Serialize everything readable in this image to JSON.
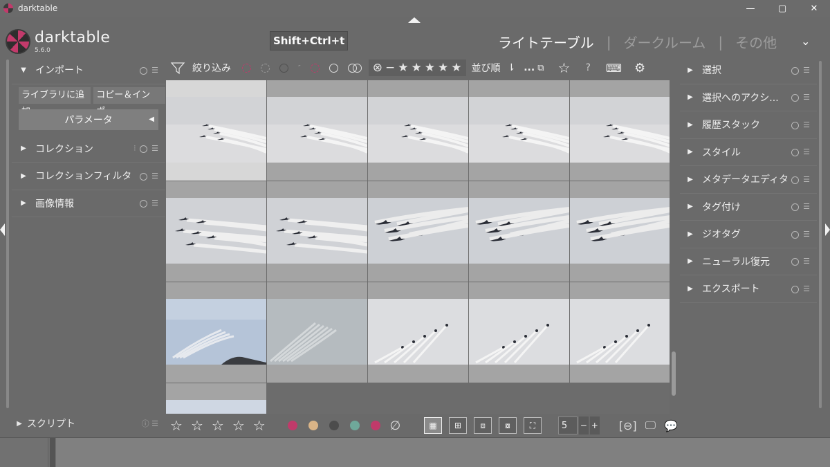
{
  "window": {
    "title": "darktable",
    "min": "—",
    "max": "▢",
    "close": "✕"
  },
  "header": {
    "logo_text": "darktable",
    "version": "5.6.0",
    "shortcut_tip": "Shift+Ctrl+t",
    "views": [
      "ライトテーブル",
      "ダークルーム",
      "その他"
    ],
    "separator": "|",
    "expand": "⌄"
  },
  "left_panel": {
    "import": {
      "label": "インポート",
      "add_to_library": "ライブラリに追加",
      "copy_import": "コピー＆インポ...",
      "params": "パラメータ"
    },
    "modules": [
      "コレクション",
      "コレクションフィルタ",
      "画像情報"
    ],
    "scripts": "スクリプト"
  },
  "top_toolbar": {
    "filter_label": "絞り込み",
    "sort_label": "並び順",
    "more": "...",
    "help": "?",
    "keyboard": "⌨",
    "settings": "⚙",
    "star_icon": "☆"
  },
  "rating_filter": {
    "reject": "⊗",
    "minus": "−",
    "stars": [
      "★",
      "★",
      "★",
      "★",
      "★"
    ]
  },
  "color_labels": [
    "#c03a6a",
    "#d9b487",
    "#4c4c4c",
    "#6fa89a",
    "#c03a6a"
  ],
  "bottom_toolbar": {
    "stars": [
      "☆",
      "☆",
      "☆",
      "☆",
      "☆"
    ],
    "none": "∅",
    "zoom_value": "5",
    "minus": "−",
    "plus": "+"
  },
  "right_panel": {
    "modules": [
      "選択",
      "選択へのアクシ...",
      "履歴スタック",
      "スタイル",
      "メタデータエディタ",
      "タグ付け",
      "ジオタグ",
      "ニューラル復元",
      "エクスポート"
    ]
  },
  "grid": {
    "columns": 5,
    "thumbnails": [
      {
        "scene": "jets-far",
        "selected": true
      },
      {
        "scene": "jets-far",
        "selected": false
      },
      {
        "scene": "jets-far",
        "selected": false
      },
      {
        "scene": "jets-far",
        "selected": false
      },
      {
        "scene": "jets-far",
        "selected": false
      },
      {
        "scene": "jets-near",
        "selected": false
      },
      {
        "scene": "jets-near",
        "selected": false
      },
      {
        "scene": "jets-close",
        "selected": false
      },
      {
        "scene": "jets-close",
        "selected": false
      },
      {
        "scene": "jets-close",
        "selected": false
      },
      {
        "scene": "trails-blue-hill",
        "selected": false
      },
      {
        "scene": "trails-gray",
        "selected": false
      },
      {
        "scene": "trails-up",
        "selected": false
      },
      {
        "scene": "trails-up",
        "selected": false
      },
      {
        "scene": "trails-up",
        "selected": false
      },
      {
        "scene": "sky-partial",
        "selected": false
      }
    ]
  }
}
